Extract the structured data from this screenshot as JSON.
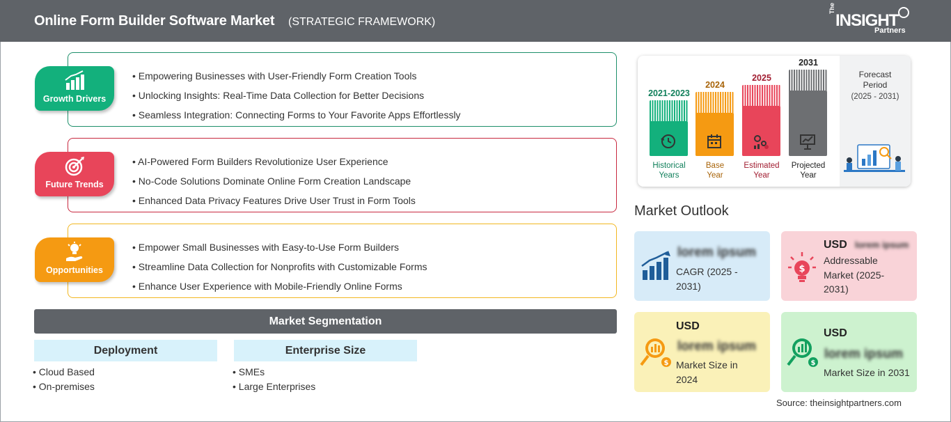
{
  "header": {
    "title": "Online Form Builder Software Market",
    "subtitle": "(STRATEGIC FRAMEWORK)",
    "logo": {
      "the": "The",
      "insight": "INSIGHT",
      "partners": "Partners"
    }
  },
  "sections": [
    {
      "label": "Growth Drivers",
      "color": "#13b07c",
      "border": "#1d8f6a",
      "icon": "bar-growth-icon",
      "items": [
        "Empowering Businesses with User-Friendly Form Creation Tools",
        "Unlocking Insights: Real-Time Data Collection for Better Decisions",
        "Seamless Integration: Connecting Forms to Your Favorite Apps Effortlessly"
      ]
    },
    {
      "label": "Future Trends",
      "color": "#e8455a",
      "border": "#c8283f",
      "icon": "target-icon",
      "items": [
        "AI-Powered Form Builders Revolutionize User Experience",
        "No-Code Solutions Dominate Online Form Creation Landscape",
        "Enhanced Data Privacy Features Drive User Trust in Form Tools"
      ]
    },
    {
      "label": "Opportunities",
      "color": "#f59a12",
      "border": "#f2b720",
      "icon": "lightbulb-hand-icon",
      "items": [
        "Empower Small Businesses with Easy-to-Use Form Builders",
        "Streamline Data Collection for Nonprofits with Customizable Forms",
        "Enhance User Experience with Mobile-Friendly Online Forms"
      ]
    }
  ],
  "segmentation": {
    "title": "Market Segmentation",
    "groups": [
      {
        "name": "Deployment",
        "items": [
          "Cloud Based",
          "On-premises"
        ]
      },
      {
        "name": "Enterprise Size",
        "items": [
          "SMEs",
          "Large Enterprises"
        ]
      }
    ]
  },
  "timeline": {
    "bars": [
      {
        "year": "2021-2023",
        "caption": [
          "Historical",
          "Years"
        ],
        "color": "#13b07c",
        "text_color": "#12805c",
        "icon": "history-icon"
      },
      {
        "year": "2024",
        "caption": [
          "Base",
          "Year"
        ],
        "color": "#f59a12",
        "text_color": "#a8640a",
        "icon": "calendar-icon"
      },
      {
        "year": "2025",
        "caption": [
          "Estimated",
          "Year"
        ],
        "color": "#e8455a",
        "text_color": "#a11c30",
        "icon": "gears-chart-icon"
      },
      {
        "year": "2031",
        "caption": [
          "Projected",
          "Year"
        ],
        "color": "#6d6f72",
        "text_color": "#222222",
        "icon": "presentation-icon"
      }
    ],
    "forecast": {
      "label": [
        "Forecast",
        "Period"
      ],
      "range": "(2025 - 2031)"
    }
  },
  "outlook": {
    "title": "Market Outlook",
    "tiles": [
      {
        "usd": "",
        "value": "lorem ipsum",
        "desc": [
          "CAGR (2025 -",
          "2031)"
        ],
        "bg": "#d7ebf8",
        "icon": "rising-bars-icon"
      },
      {
        "usd": "USD",
        "value": "lorem ipsum",
        "desc": [
          "Addressable",
          "Market (2025-",
          "2031)"
        ],
        "bg": "#f9d3d8",
        "icon": "dollar-bulb-icon"
      },
      {
        "usd": "USD",
        "value": "lorem ipsum",
        "desc": [
          "Market Size in",
          "2024"
        ],
        "bg": "#faf1b8",
        "icon": "magnifier-chart-icon"
      },
      {
        "usd": "USD",
        "value": "lorem ipsum",
        "desc": [
          "Market Size in 2031"
        ],
        "bg": "#cdf2cf",
        "icon": "magnifier-growth-icon"
      }
    ]
  },
  "source": "Source: theinsightpartners.com"
}
